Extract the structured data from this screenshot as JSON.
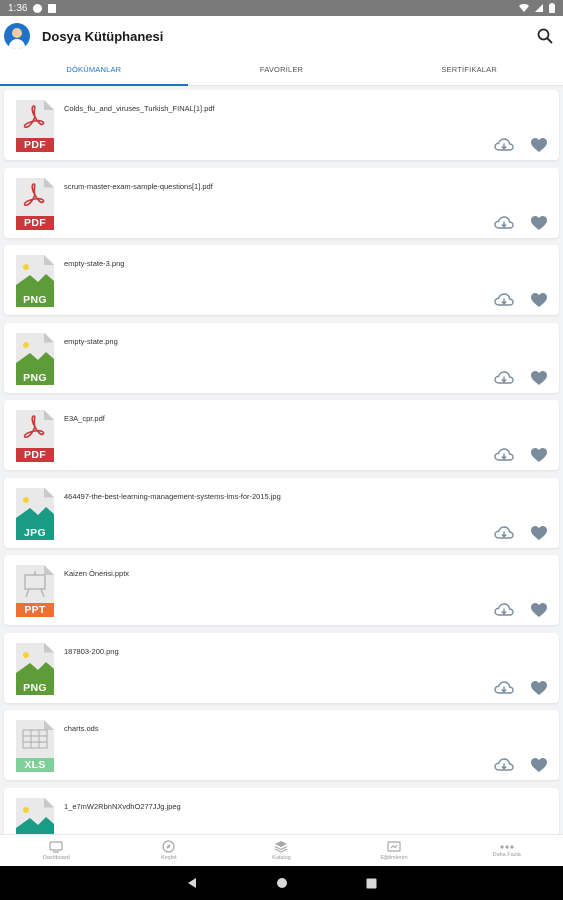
{
  "status_bar": {
    "time": "1:36"
  },
  "app_bar": {
    "title": "Dosya Kütüphanesi"
  },
  "tabs": [
    {
      "label": "DÖKÜMANLAR",
      "active": true
    },
    {
      "label": "FAVORİLER",
      "active": false
    },
    {
      "label": "SERTİFİKALAR",
      "active": false
    }
  ],
  "files": [
    {
      "name": "Colds_flu_and_viruses_Turkish_FINAL[1].pdf",
      "type": "PDF",
      "icon": "pdf-file-icon"
    },
    {
      "name": "scrum-master-exam-sample-questions[1].pdf",
      "type": "PDF",
      "icon": "pdf-file-icon"
    },
    {
      "name": "empty-state-3.png",
      "type": "PNG",
      "icon": "image-file-icon"
    },
    {
      "name": "empty-state.png",
      "type": "PNG",
      "icon": "image-file-icon"
    },
    {
      "name": "E3A_cpr.pdf",
      "type": "PDF",
      "icon": "pdf-file-icon"
    },
    {
      "name": "464497-the-best-learning-management-systems-lms-for-2015.jpg",
      "type": "JPG",
      "icon": "image-file-icon"
    },
    {
      "name": "Kaizen Önerisi.pptx",
      "type": "PPT",
      "icon": "presentation-file-icon"
    },
    {
      "name": "187803-200.png",
      "type": "PNG",
      "icon": "image-file-icon"
    },
    {
      "name": "charts.ods",
      "type": "XLS",
      "icon": "spreadsheet-file-icon"
    },
    {
      "name": "1_e7mW2RbnNXvdhO277JJg.jpeg",
      "type": "",
      "icon": "image-file-icon"
    }
  ],
  "bottom_nav": [
    {
      "label": "Dashboard",
      "icon": "dashboard-icon"
    },
    {
      "label": "Keşfet",
      "icon": "compass-icon"
    },
    {
      "label": "Katalog",
      "icon": "layers-icon"
    },
    {
      "label": "Eğitimlerim",
      "icon": "trainings-icon"
    },
    {
      "label": "Daha Fazla",
      "icon": "more-icon"
    }
  ],
  "colors": {
    "accent": "#1e73c9",
    "pdf": "#c9383a",
    "png": "#5e9c3a",
    "jpg": "#199b85",
    "ppt": "#ee7034",
    "xls": "#7fcf9a",
    "action_icon": "#7a8c9c"
  }
}
